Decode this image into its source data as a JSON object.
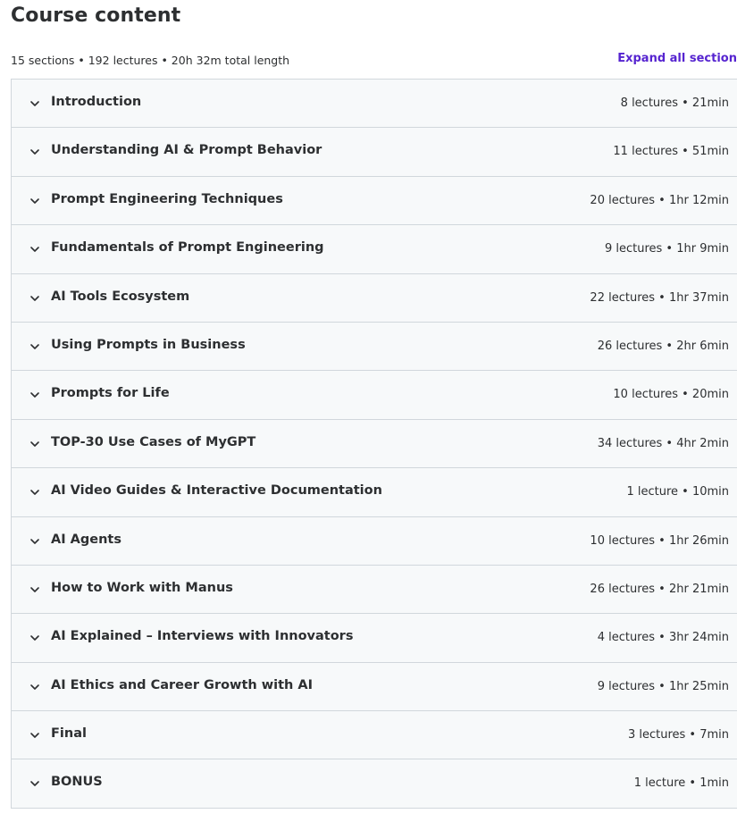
{
  "header": {
    "title": "Course content",
    "summary": "15 sections • 192 lectures • 20h 32m total length",
    "expand_all_label": "Expand all section"
  },
  "colors": {
    "accent": "#5624d0",
    "row_background": "#f7f9fa",
    "border": "#d1d7dc",
    "text": "#2d2f31"
  },
  "icons": {
    "section_toggle": "chevron-down-icon"
  },
  "sections": [
    {
      "title": "Introduction",
      "meta": "8 lectures • 21min"
    },
    {
      "title": "Understanding AI & Prompt Behavior",
      "meta": "11 lectures • 51min"
    },
    {
      "title": "Prompt Engineering Techniques",
      "meta": "20 lectures • 1hr 12min"
    },
    {
      "title": "Fundamentals of Prompt Engineering",
      "meta": "9 lectures • 1hr 9min"
    },
    {
      "title": "AI Tools Ecosystem",
      "meta": "22 lectures • 1hr 37min"
    },
    {
      "title": "Using Prompts in Business",
      "meta": "26 lectures • 2hr 6min"
    },
    {
      "title": "Prompts for Life",
      "meta": "10 lectures • 20min"
    },
    {
      "title": "TOP-30 Use Cases of MyGPT",
      "meta": "34 lectures • 4hr 2min"
    },
    {
      "title": "AI Video Guides & Interactive Documentation",
      "meta": "1 lecture • 10min"
    },
    {
      "title": "AI Agents",
      "meta": "10 lectures • 1hr 26min"
    },
    {
      "title": "How to Work with Manus",
      "meta": "26 lectures • 2hr 21min"
    },
    {
      "title": "AI Explained – Interviews with Innovators",
      "meta": "4 lectures • 3hr 24min"
    },
    {
      "title": "AI Ethics and Career Growth with AI",
      "meta": "9 lectures • 1hr 25min"
    },
    {
      "title": "Final",
      "meta": "3 lectures • 7min"
    },
    {
      "title": "BONUS",
      "meta": "1 lecture • 1min"
    }
  ]
}
